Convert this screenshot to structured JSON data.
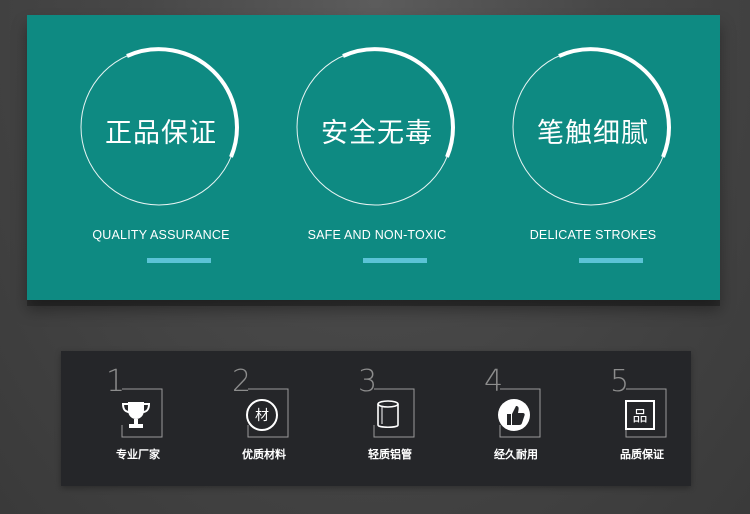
{
  "features": [
    {
      "title_cn": "正品保证",
      "title_en": "QUALITY ASSURANCE"
    },
    {
      "title_cn": "安全无毒",
      "title_en": "SAFE AND NON-TOXIC"
    },
    {
      "title_cn": "笔触细腻",
      "title_en": "DELICATE STROKES"
    }
  ],
  "items": [
    {
      "number": "1",
      "label": "专业厂家",
      "icon": "trophy-icon"
    },
    {
      "number": "2",
      "label": "优质材料",
      "icon": "material-badge-icon",
      "badge": "材"
    },
    {
      "number": "3",
      "label": "轻质铝管",
      "icon": "aluminum-tube-icon"
    },
    {
      "number": "4",
      "label": "经久耐用",
      "icon": "thumbs-up-icon"
    },
    {
      "number": "5",
      "label": "品质保证",
      "icon": "quality-box-icon",
      "badge": "品"
    }
  ],
  "colors": {
    "teal": "#0e8a82",
    "accent_bar": "#5bc3d6",
    "dark_panel": "#252629"
  }
}
